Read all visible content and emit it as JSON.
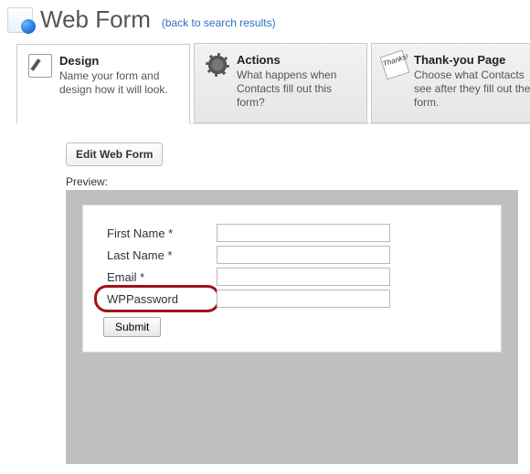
{
  "header": {
    "title": "Web Form",
    "back_link": "(back to search results)"
  },
  "tabs": [
    {
      "title": "Design",
      "desc": "Name your form and design how it will look."
    },
    {
      "title": "Actions",
      "desc": "What happens when Contacts fill out this form?"
    },
    {
      "title": "Thank-you Page",
      "desc": "Choose what Contacts see after they fill out the form."
    }
  ],
  "buttons": {
    "edit": "Edit Web Form",
    "submit": "Submit"
  },
  "labels": {
    "preview": "Preview:"
  },
  "form_fields": [
    {
      "label": "First Name *",
      "value": ""
    },
    {
      "label": "Last Name *",
      "value": ""
    },
    {
      "label": "Email *",
      "value": ""
    },
    {
      "label": "WPPassword",
      "value": ""
    }
  ],
  "icons": {
    "thanks_text": "Thanks!"
  }
}
